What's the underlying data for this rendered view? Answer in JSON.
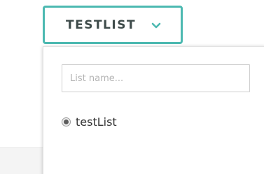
{
  "list_selector": {
    "current_label": "TESTLIST",
    "toggle_icon": "chevron-down-icon",
    "accent_color": "#4cb9b1"
  },
  "dropdown": {
    "name_input": {
      "placeholder": "List name...",
      "value": ""
    },
    "options": [
      {
        "label": "testList",
        "selected": true
      }
    ]
  }
}
